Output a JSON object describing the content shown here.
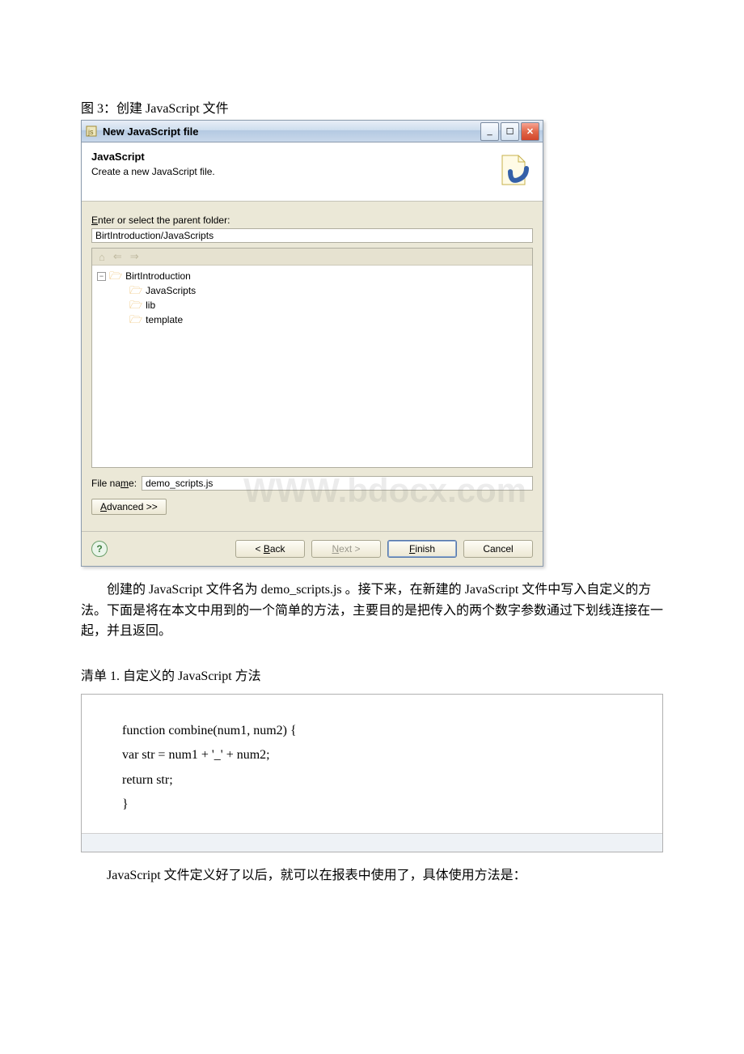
{
  "caption": "图 3：创建 JavaScript 文件",
  "dialog": {
    "title": "New JavaScript file",
    "heading": "JavaScript",
    "subheading": "Create a new JavaScript file.",
    "parent_label": "Enter or select the parent folder:",
    "parent_value": "BirtIntroduction/JavaScripts",
    "tree": {
      "root": "BirtIntroduction",
      "children": [
        "JavaScripts",
        "lib",
        "template"
      ]
    },
    "filename_label": "File name:",
    "filename_value": "demo_scripts.js",
    "advanced": "Advanced >>",
    "watermark": "WWW.bdocx.com",
    "buttons": {
      "back": "< Back",
      "next": "Next >",
      "finish": "Finish",
      "cancel": "Cancel"
    },
    "winbtn": {
      "min": "_",
      "max": "☐",
      "close": "✕"
    }
  },
  "paragraph1": "创建的 JavaScript 文件名为 demo_scripts.js 。接下来，在新建的 JavaScript 文件中写入自定义的方法。下面是将在本文中用到的一个简单的方法，主要目的是把传入的两个数字参数通过下划线连接在一起，并且返回。",
  "listing_title": "清单 1. 自定义的 JavaScript 方法",
  "code": {
    "l1": "function combine(num1, num2) {",
    "l2": " var str = num1 + '_' + num2;",
    "l3": " return str;",
    "l4": " }"
  },
  "paragraph2": "JavaScript 文件定义好了以后，就可以在报表中使用了，具体使用方法是："
}
